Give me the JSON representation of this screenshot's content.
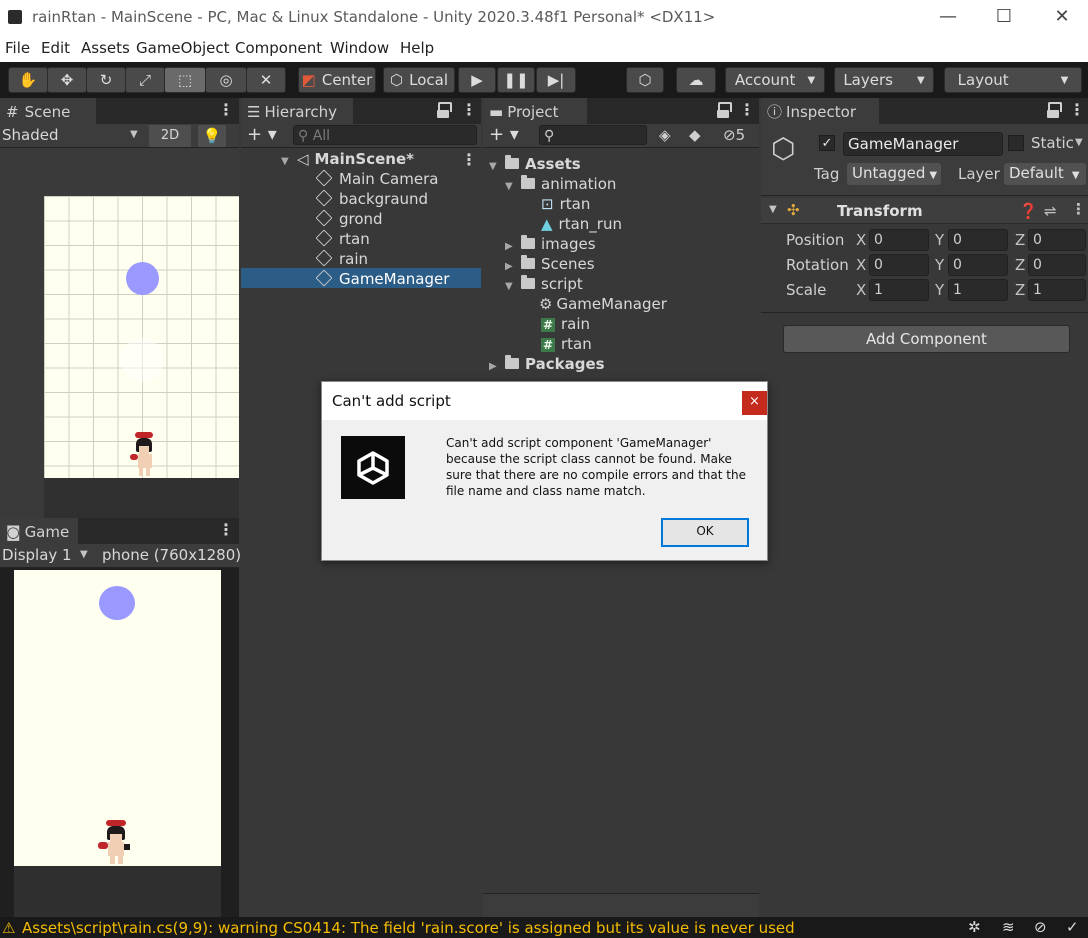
{
  "window": {
    "title": "rainRtan - MainScene - PC, Mac & Linux Standalone - Unity 2020.3.48f1 Personal* <DX11>",
    "minimize": "—",
    "maximize": "☐",
    "close": "✕"
  },
  "menu": [
    "File",
    "Edit",
    "Assets",
    "GameObject",
    "Component",
    "Window",
    "Help"
  ],
  "toolbar": {
    "pivot": "Center",
    "space": "Local",
    "account": "Account",
    "layers": "Layers",
    "layout": "Layout"
  },
  "scene": {
    "tab": "Scene",
    "shading": "Shaded",
    "mode2d": "2D"
  },
  "game": {
    "tab": "Game",
    "display": "Display 1",
    "resolution": "phone (760x1280)"
  },
  "hierarchy": {
    "tab": "Hierarchy",
    "search_placeholder": "All",
    "scene_name": "MainScene*",
    "items": [
      "Main Camera",
      "backgraund",
      "grond",
      "rtan",
      "rain",
      "GameManager"
    ],
    "selected": "GameManager"
  },
  "project": {
    "tab": "Project",
    "hidden_count": "5",
    "assets": "Assets",
    "animation": "animation",
    "anim_items": [
      "rtan",
      "rtan_run"
    ],
    "images": "images",
    "scenes": "Scenes",
    "script": "script",
    "script_items": [
      "GameManager",
      "rain",
      "rtan"
    ],
    "packages": "Packages"
  },
  "inspector": {
    "tab": "Inspector",
    "object_name": "GameManager",
    "static_label": "Static",
    "tag_label": "Tag",
    "tag_value": "Untagged",
    "layer_label": "Layer",
    "layer_value": "Default",
    "transform_title": "Transform",
    "rows": [
      {
        "label": "Position",
        "x": "0",
        "y": "0",
        "z": "0"
      },
      {
        "label": "Rotation",
        "x": "0",
        "y": "0",
        "z": "0"
      },
      {
        "label": "Scale",
        "x": "1",
        "y": "1",
        "z": "1"
      }
    ],
    "axis_x": "X",
    "axis_y": "Y",
    "axis_z": "Z",
    "add_component": "Add Component"
  },
  "dialog": {
    "title": "Can't add script",
    "message": "Can't add script component 'GameManager' because the script class cannot be found. Make sure that there are no compile errors and that the file name and class name match.",
    "ok": "OK",
    "close": "×"
  },
  "status": {
    "warning": "Assets\\script\\rain.cs(9,9): warning CS0414: The field 'rain.score' is assigned but its value is never used"
  },
  "colors": {
    "background": "#383838",
    "selection": "#2c5d87",
    "scene_bg": "#fffff0",
    "rain_drop": "#9999ff",
    "warning": "#f4bc02"
  }
}
